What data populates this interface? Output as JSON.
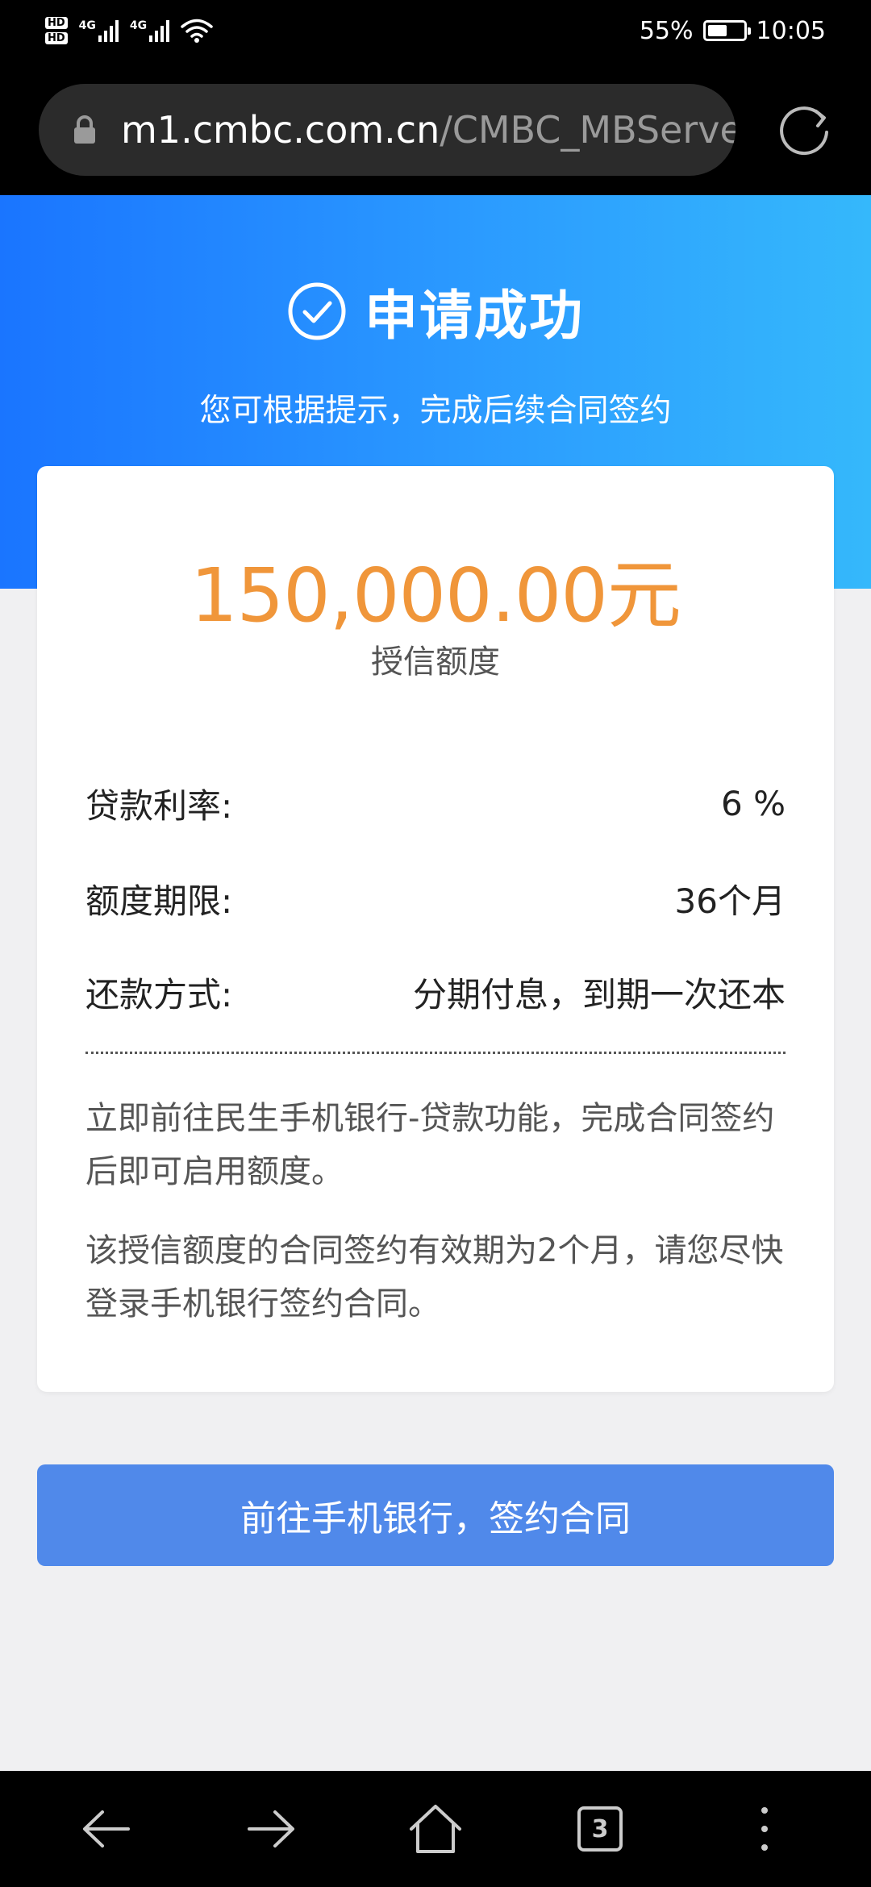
{
  "status_bar": {
    "hd1": "HD",
    "hd2": "HD",
    "net1": "4G",
    "net2": "4G",
    "battery_percent": "55%",
    "battery_level": 0.55,
    "time": "10:05"
  },
  "browser": {
    "url_host": "m1.cmbc.com.cn",
    "url_path": "/CMBC_MBServe",
    "tab_count": "3",
    "icons": {
      "lock": "lock-icon",
      "reload": "reload-icon",
      "back": "back-arrow-icon",
      "forward": "forward-arrow-icon",
      "home": "home-icon",
      "tabs": "tabs-icon",
      "menu": "more-menu-icon"
    }
  },
  "header": {
    "title": "申请成功",
    "subtitle": "您可根据提示，完成后续合同签约",
    "icon": "check-circle-icon"
  },
  "credit": {
    "amount": "150,000.00元",
    "amount_label": "授信额度"
  },
  "details": [
    {
      "key": "贷款利率:",
      "value": "6 %"
    },
    {
      "key": "额度期限:",
      "value": "36个月"
    },
    {
      "key": "还款方式:",
      "value": "分期付息，到期一次还本"
    }
  ],
  "notes": [
    "立即前往民生手机银行-贷款功能，完成合同签约后即可启用额度。",
    "该授信额度的合同签约有效期为2个月，请您尽快登录手机银行签约合同。"
  ],
  "action": {
    "button_label": "前往手机银行，签约合同"
  },
  "colors": {
    "gradient_start": "#1a75ff",
    "gradient_end": "#35b8fb",
    "amount": "#f0963a",
    "button": "#5089ea",
    "page_bg": "#f0f0f2"
  }
}
